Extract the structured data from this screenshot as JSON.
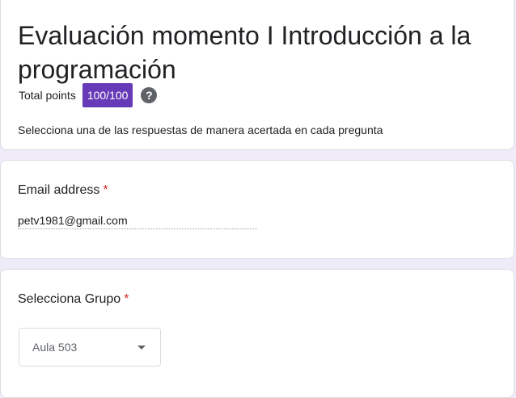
{
  "form": {
    "title": "Evaluación momento I Introducción a la programación",
    "total_points_label": "Total points",
    "score": "100/100",
    "help_icon": "question-mark-icon",
    "description": "Selecciona una de las respuestas de manera acertada en cada pregunta"
  },
  "email_question": {
    "label": "Email address",
    "required_mark": "*",
    "value": "petv1981@gmail.com"
  },
  "group_question": {
    "label": "Selecciona Grupo",
    "required_mark": "*",
    "selected": "Aula 503",
    "caret_icon": "dropdown-caret-icon"
  },
  "colors": {
    "accent": "#673ab7",
    "required": "#d93025",
    "background": "#f0ebf8"
  }
}
